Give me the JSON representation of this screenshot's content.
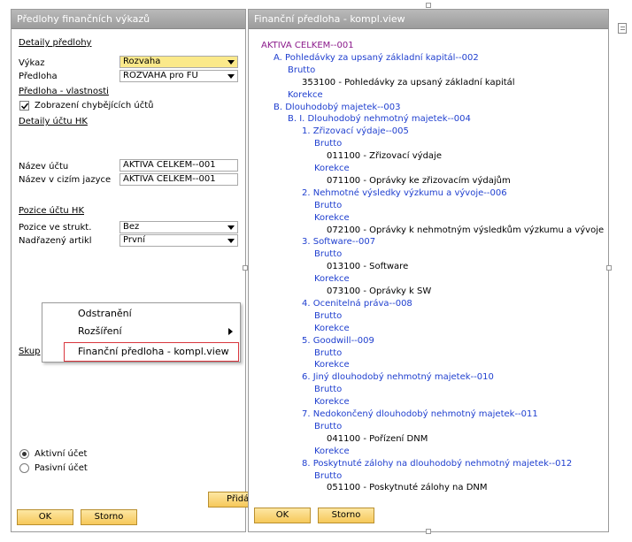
{
  "left_window": {
    "title": "Předlohy finančních výkazů",
    "section_details": "Detaily předlohy",
    "label_vykaz": "Výkaz",
    "value_vykaz": "Rozvaha",
    "label_predloha": "Předloha",
    "value_predloha": "ROZVAHA pro FÚ",
    "link_vlastnosti": "Předloha - vlastnosti",
    "checkbox_label": "Zobrazení chybějících účtů",
    "link_detaily_uctu": "Detaily účtu HK",
    "label_nazev_uctu": "Název účtu",
    "value_nazev_uctu": "AKTIVA CELKEM--001",
    "label_nazev_cizi": "Název v cizím jazyce",
    "value_nazev_cizi": "AKTIVA CELKEM--001",
    "link_pozice": "Pozice účtu HK",
    "label_pozice_strukt": "Pozice ve strukt.",
    "value_pozice_strukt": "Bez",
    "label_nadrazeny": "Nadřazený artikl",
    "value_nadrazeny": "První",
    "label_skup": "Skup",
    "radio_aktivni": "Aktivní účet",
    "radio_pasivni": "Pasivní účet",
    "btn_prida": "Přidá",
    "btn_ok": "OK",
    "btn_storno": "Storno"
  },
  "context_menu": {
    "items": [
      "Odstranění",
      "Rozšíření",
      "Finanční předloha - kompl.view"
    ]
  },
  "right_window": {
    "title": "Finanční předloha - kompl.view",
    "btn_ok": "OK",
    "btn_storno": "Storno",
    "tree": [
      {
        "text": "AKTIVA CELKEM--001",
        "level": 0,
        "kind": "root"
      },
      {
        "text": "A. Pohledávky za upsaný základní kapitál--002",
        "level": 1,
        "kind": "node"
      },
      {
        "text": "Brutto",
        "level": 2,
        "kind": "node"
      },
      {
        "text": "353100 - Pohledávky za upsaný základní kapitál",
        "level": 3,
        "kind": "account"
      },
      {
        "text": "Korekce",
        "level": 2,
        "kind": "node"
      },
      {
        "text": "B. Dlouhodobý majetek--003",
        "level": 1,
        "kind": "node"
      },
      {
        "text": "B. I. Dlouhodobý nehmotný majetek--004",
        "level": 2,
        "kind": "node"
      },
      {
        "text": "1. Zřizovací výdaje--005",
        "level": 3,
        "kind": "node"
      },
      {
        "text": "Brutto",
        "level": 4,
        "kind": "node"
      },
      {
        "text": "011100 - Zřizovací výdaje",
        "level": 5,
        "kind": "account"
      },
      {
        "text": "Korekce",
        "level": 4,
        "kind": "node"
      },
      {
        "text": "071100 - Oprávky ke zřizovacím výdajům",
        "level": 5,
        "kind": "account"
      },
      {
        "text": "2. Nehmotné výsledky výzkumu a vývoje--006",
        "level": 3,
        "kind": "node"
      },
      {
        "text": "Brutto",
        "level": 4,
        "kind": "node"
      },
      {
        "text": "Korekce",
        "level": 4,
        "kind": "node"
      },
      {
        "text": "072100 - Oprávky k nehmotným výsledkům výzkumu a vývoje",
        "level": 5,
        "kind": "account"
      },
      {
        "text": "3. Software--007",
        "level": 3,
        "kind": "node"
      },
      {
        "text": "Brutto",
        "level": 4,
        "kind": "node"
      },
      {
        "text": "013100 - Software",
        "level": 5,
        "kind": "account"
      },
      {
        "text": "Korekce",
        "level": 4,
        "kind": "node"
      },
      {
        "text": "073100 - Oprávky k SW",
        "level": 5,
        "kind": "account"
      },
      {
        "text": "4. Ocenitelná práva--008",
        "level": 3,
        "kind": "node"
      },
      {
        "text": "Brutto",
        "level": 4,
        "kind": "node"
      },
      {
        "text": "Korekce",
        "level": 4,
        "kind": "node"
      },
      {
        "text": "5. Goodwill--009",
        "level": 3,
        "kind": "node"
      },
      {
        "text": "Brutto",
        "level": 4,
        "kind": "node"
      },
      {
        "text": "Korekce",
        "level": 4,
        "kind": "node"
      },
      {
        "text": "6. Jiný dlouhodobý nehmotný majetek--010",
        "level": 3,
        "kind": "node"
      },
      {
        "text": "Brutto",
        "level": 4,
        "kind": "node"
      },
      {
        "text": "Korekce",
        "level": 4,
        "kind": "node"
      },
      {
        "text": "7. Nedokončený dlouhodobý nehmotný majetek--011",
        "level": 3,
        "kind": "node"
      },
      {
        "text": "Brutto",
        "level": 4,
        "kind": "node"
      },
      {
        "text": "041100 - Pořízení DNM",
        "level": 5,
        "kind": "account"
      },
      {
        "text": "Korekce",
        "level": 4,
        "kind": "node"
      },
      {
        "text": "8. Poskytnuté zálohy na dlouhodobý nehmotný majetek--012",
        "level": 3,
        "kind": "node"
      },
      {
        "text": "Brutto",
        "level": 4,
        "kind": "node"
      },
      {
        "text": "051100 - Poskytnuté zálohy na DNM",
        "level": 5,
        "kind": "account"
      }
    ]
  },
  "colors": {
    "root": "#8b1a8b",
    "node": "#1f3fcf",
    "account": "#000000",
    "menu_highlight_border": "#d9363e"
  }
}
